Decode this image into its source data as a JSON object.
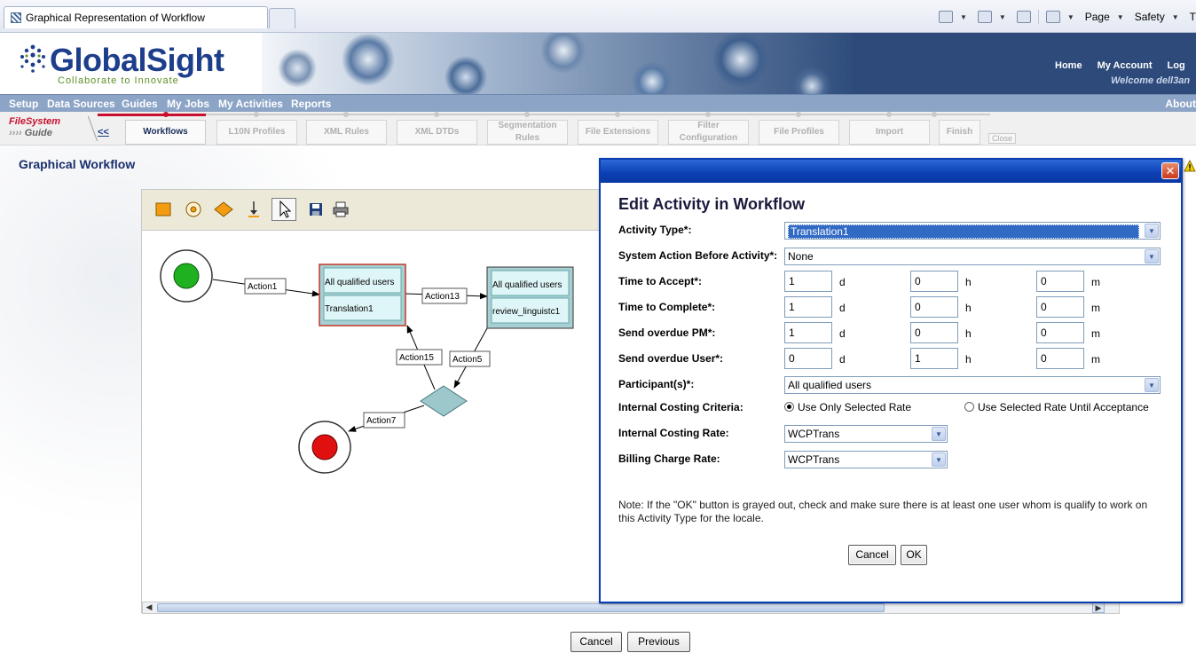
{
  "browser": {
    "tab_title": "Graphical Representation of Workflow",
    "commands": {
      "page": "Page",
      "safety": "Safety",
      "tools_cut": "T"
    }
  },
  "header": {
    "logo_name": "GlobalSight",
    "logo_tagline": "Collaborate to Innovate",
    "links": [
      "Home",
      "My Account",
      "Log"
    ],
    "welcome": "Welcome dell3an"
  },
  "nav": {
    "items": [
      "Setup",
      "Data Sources",
      "Guides",
      "My Jobs",
      "My Activities",
      "Reports"
    ],
    "about": "About"
  },
  "guide": {
    "logo_line1": "FileSystem",
    "logo_line2": "Guide",
    "back": "<<",
    "steps": [
      "Workflows",
      "L10N Profiles",
      "XML Rules",
      "XML DTDs",
      "Segmentation\nRules",
      "File Extensions",
      "Filter\nConfiguration",
      "File Profiles",
      "Import",
      "Finish"
    ],
    "close": "Close"
  },
  "page": {
    "title": "Graphical Workflow",
    "cancel": "Cancel",
    "previous": "Previous"
  },
  "toolbar": {
    "tools": [
      "activity-node-icon",
      "condition-node-icon",
      "decision-node-icon",
      "exit-node-icon",
      "pointer-icon",
      "save-icon",
      "print-icon"
    ]
  },
  "workflow": {
    "node1_line1": "All qualified users",
    "node1_line2": "Translation1",
    "node2_line1": "All qualified users",
    "node2_line2": "review_linguistc1",
    "action1": "Action1",
    "action13": "Action13",
    "action15": "Action15",
    "action5": "Action5",
    "action7": "Action7"
  },
  "dialog": {
    "title": "Edit Activity in Workflow",
    "activity_type_label": "Activity Type*:",
    "activity_type_value": "Translation1",
    "system_action_label": "System Action Before Activity*:",
    "system_action_value": "None",
    "time_to_accept_label": "Time to Accept*:",
    "time_to_accept": {
      "d": "1",
      "h": "0",
      "m": "0"
    },
    "time_to_complete_label": "Time to Complete*:",
    "time_to_complete": {
      "d": "1",
      "h": "0",
      "m": "0"
    },
    "overdue_pm_label": "Send overdue PM*:",
    "overdue_pm": {
      "d": "1",
      "h": "0",
      "m": "0"
    },
    "overdue_user_label": "Send overdue User*:",
    "overdue_user": {
      "d": "0",
      "h": "1",
      "m": "0"
    },
    "unit_d": "d",
    "unit_h": "h",
    "unit_m": "m",
    "participants_label": "Participant(s)*:",
    "participants_value": "All qualified users",
    "costing_criteria_label": "Internal Costing Criteria:",
    "radio_selected": "Use Only Selected Rate",
    "radio_until": "Use Selected Rate Until Acceptance",
    "costing_rate_label": "Internal Costing Rate:",
    "costing_rate_value": "WCPTrans",
    "billing_rate_label": "Billing Charge Rate:",
    "billing_rate_value": "WCPTrans",
    "note": "Note: If the \"OK\" button is grayed out, check and make sure there is at least one user whom is qualify to work on this Activity Type for the locale.",
    "cancel": "Cancel",
    "ok": "OK",
    "close_glyph": "✕"
  }
}
